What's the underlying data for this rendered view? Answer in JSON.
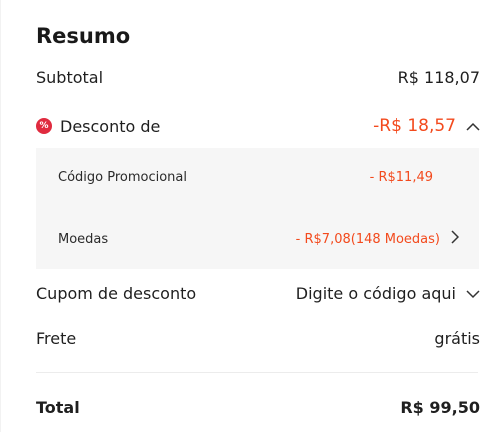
{
  "summary": {
    "title": "Resumo",
    "subtotal": {
      "label": "Subtotal",
      "value": "R$ 118,07"
    },
    "discount": {
      "label": "Desconto de",
      "value": "-R$ 18,57",
      "badge_icon": "discount-percent-icon",
      "expanded_icon": "chevron-up-icon",
      "items": [
        {
          "label": "Código Promocional",
          "value": "- R$11,49"
        },
        {
          "label": "Moedas",
          "value": "- R$7,08(148 Moedas)",
          "icon": "chevron-right-icon"
        }
      ]
    },
    "coupon": {
      "label": "Cupom de desconto",
      "value": "Digite o código aqui",
      "icon": "chevron-down-icon"
    },
    "shipping": {
      "label": "Frete",
      "value": "grátis"
    },
    "total": {
      "label": "Total",
      "value": "R$ 99,50"
    }
  },
  "colors": {
    "accent_red": "#f34a1d",
    "badge_red": "#e02b3f",
    "panel_bg": "#f6f6f6"
  }
}
